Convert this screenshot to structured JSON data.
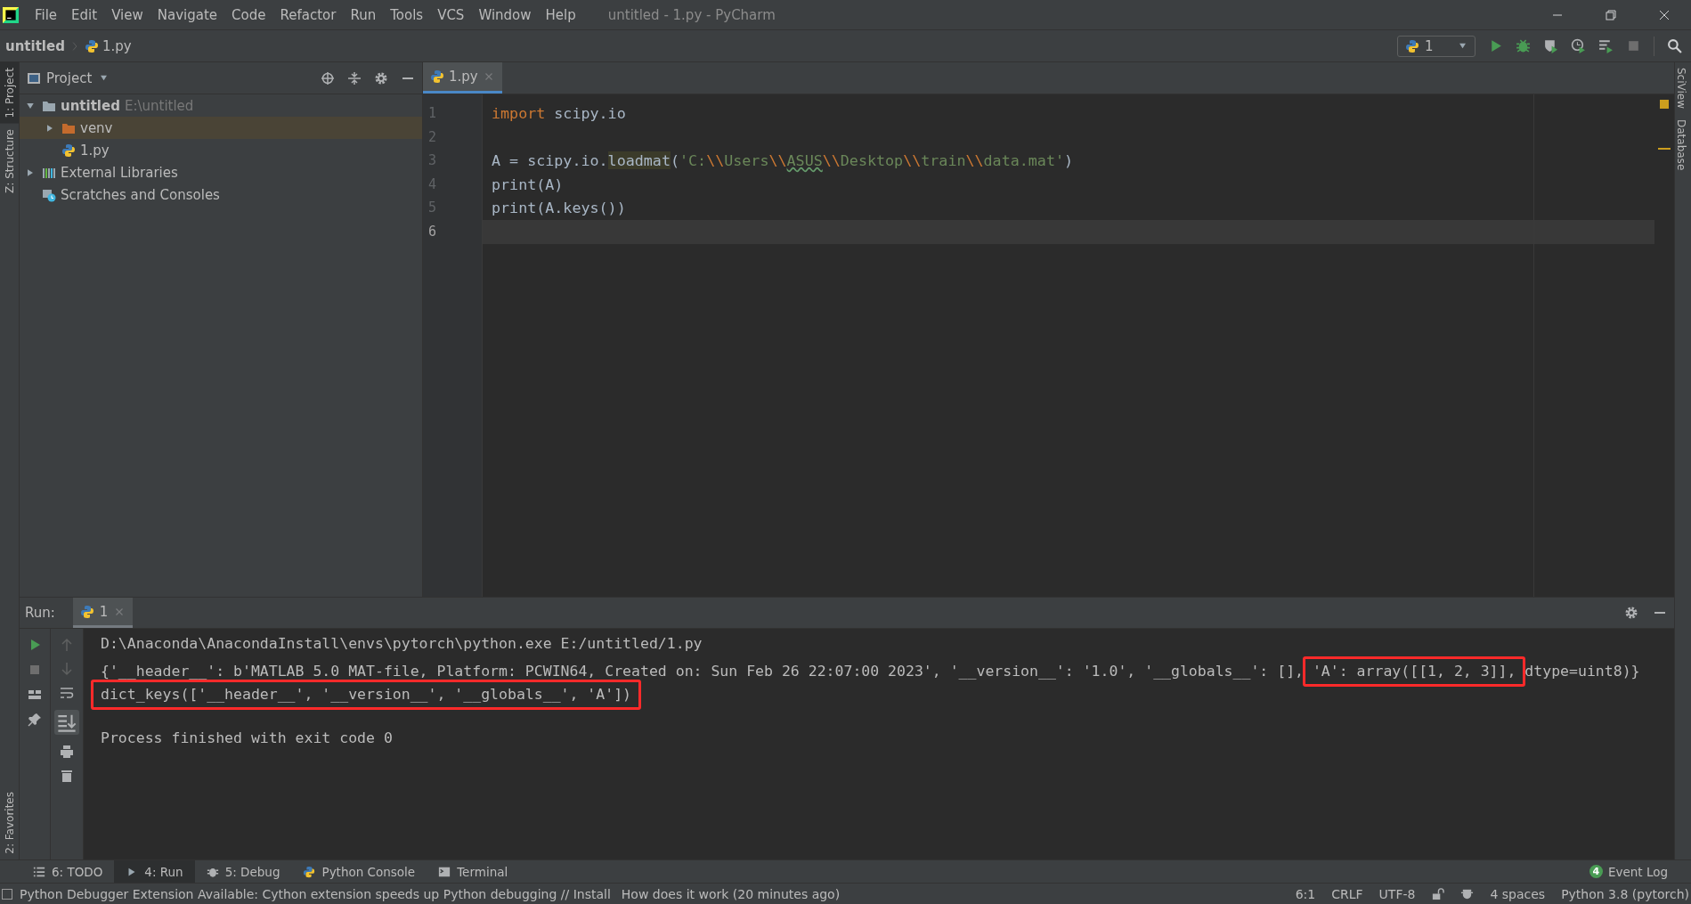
{
  "window": {
    "title": "untitled - 1.py - PyCharm"
  },
  "menu": [
    "File",
    "Edit",
    "View",
    "Navigate",
    "Code",
    "Refactor",
    "Run",
    "Tools",
    "VCS",
    "Window",
    "Help"
  ],
  "breadcrumb": [
    "untitled",
    "1.py"
  ],
  "run_config": {
    "label": "1"
  },
  "left_strip": [
    {
      "label": "1: Project",
      "selected": true
    },
    {
      "label": "Z: Structure",
      "selected": false
    },
    {
      "label": "2: Favorites",
      "selected": false
    }
  ],
  "right_strip": [
    {
      "label": "SciView"
    },
    {
      "label": "Database"
    }
  ],
  "project": {
    "title": "Project",
    "tree": [
      {
        "kind": "folder",
        "label": "untitled",
        "hint": "E:\\untitled",
        "expanded": true,
        "selected": false,
        "children": [
          {
            "kind": "excluded-folder",
            "label": "venv",
            "expanded": false,
            "selected": true
          },
          {
            "kind": "python-file",
            "label": "1.py",
            "selected": false
          }
        ]
      },
      {
        "kind": "libraries",
        "label": "External Libraries",
        "expanded": false,
        "selected": false
      },
      {
        "kind": "scratches",
        "label": "Scratches and Consoles",
        "selected": false
      }
    ]
  },
  "editor": {
    "tabs": [
      {
        "label": "1.py",
        "selected": true
      }
    ],
    "lines": [
      {
        "number": "1",
        "current": false,
        "tokens": [
          {
            "kind": "keyword",
            "text": "import"
          },
          {
            "kind": "plain",
            "text": " scipy.io"
          }
        ]
      },
      {
        "number": "2",
        "current": false
      },
      {
        "number": "3",
        "current": false,
        "tokens": [
          {
            "kind": "plain",
            "text": "A = scipy.io."
          },
          {
            "kind": "call",
            "text": "loadmat"
          },
          {
            "kind": "plain",
            "text": "("
          },
          {
            "kind": "string",
            "text": "'C:"
          },
          {
            "kind": "escape",
            "text": "\\\\"
          },
          {
            "kind": "string",
            "text": "Users"
          },
          {
            "kind": "escape",
            "text": "\\\\"
          },
          {
            "kind": "typo",
            "text": "ASUS"
          },
          {
            "kind": "escape",
            "text": "\\\\"
          },
          {
            "kind": "string",
            "text": "Desktop"
          },
          {
            "kind": "escape",
            "text": "\\\\"
          },
          {
            "kind": "string",
            "text": "train"
          },
          {
            "kind": "escape",
            "text": "\\\\"
          },
          {
            "kind": "string",
            "text": "data.mat'"
          },
          {
            "kind": "plain",
            "text": ")"
          }
        ]
      },
      {
        "number": "4",
        "current": false,
        "tokens": [
          {
            "kind": "plain",
            "text": "print(A)"
          }
        ]
      },
      {
        "number": "5",
        "current": false,
        "tokens": [
          {
            "kind": "plain",
            "text": "print(A.keys())"
          }
        ]
      },
      {
        "number": "6",
        "current": true
      }
    ]
  },
  "run": {
    "label": "Run:",
    "tabs": [
      {
        "label": "1",
        "selected": true
      }
    ],
    "output": [
      {
        "kind": "command",
        "segments": [
          {
            "text": "D:\\Anaconda\\AnacondaInstall\\envs\\pytorch\\python.exe E:/untitled/1.py",
            "boxed": false
          }
        ]
      },
      {
        "kind": "output",
        "segments": [
          {
            "text": "{'__header__': b'MATLAB 5.0 MAT-file, Platform: PCWIN64, Created on: Sun Feb 26 22:07:00 2023', '__version__': '1.0', '__globals__': [], ",
            "boxed": false
          },
          {
            "text": "'A': array([[1, 2, 3]],",
            "boxed": true
          },
          {
            "text": " dtype=uint8)}",
            "boxed": false
          }
        ]
      },
      {
        "kind": "output",
        "segments": [
          {
            "text": "dict_keys(['__header__', '__version__', '__globals__', 'A'])",
            "boxed": true
          }
        ]
      },
      {
        "kind": "exit",
        "segments": [
          {
            "text": "Process finished with exit code 0",
            "boxed": false
          }
        ]
      }
    ]
  },
  "tool_tabs": [
    {
      "kind": "list",
      "label": "6: TODO",
      "selected": false
    },
    {
      "kind": "run",
      "label": "4: Run",
      "selected": true
    },
    {
      "kind": "bug",
      "label": "5: Debug",
      "selected": false
    },
    {
      "kind": "python",
      "label": "Python Console",
      "selected": false
    },
    {
      "kind": "terminal",
      "label": "Terminal",
      "selected": false
    }
  ],
  "event_log": {
    "label": "Event Log",
    "count": "4"
  },
  "status_bar": {
    "message": "Python Debugger Extension Available: Cython extension speeds up Python debugging // Install",
    "link": "How does it work (20 minutes ago)",
    "items": [
      {
        "kind": "text",
        "text": "6:1"
      },
      {
        "kind": "text",
        "text": "CRLF"
      },
      {
        "kind": "text",
        "text": "UTF-8"
      },
      {
        "kind": "lock"
      },
      {
        "kind": "inspector"
      },
      {
        "kind": "text",
        "text": "4 spaces"
      },
      {
        "kind": "text",
        "text": "Python 3.8 (pytorch)"
      }
    ]
  }
}
